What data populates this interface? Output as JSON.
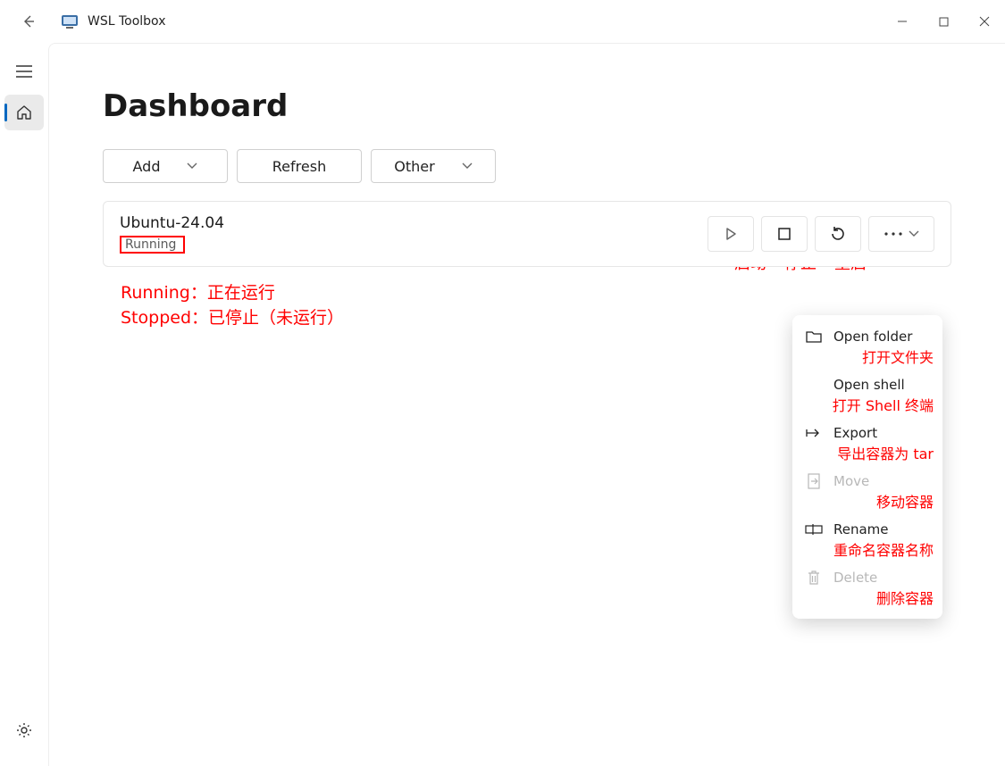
{
  "app": {
    "title": "WSL Toolbox"
  },
  "page": {
    "heading": "Dashboard"
  },
  "toolbar": {
    "add": "Add",
    "refresh": "Refresh",
    "other": "Other"
  },
  "action_labels": {
    "start": "启动",
    "stop": "停止",
    "restart": "重启"
  },
  "distro": {
    "name": "Ubuntu-24.04",
    "status": "Running"
  },
  "legend": {
    "running": "Running：正在运行",
    "stopped": "Stopped：已停止（未运行）"
  },
  "menu": {
    "open_folder": "Open folder",
    "open_folder_cn": "打开文件夹",
    "open_shell": "Open shell",
    "open_shell_cn": "打开 Shell 终端",
    "export": "Export",
    "export_cn": "导出容器为 tar",
    "move": "Move",
    "move_cn": "移动容器",
    "rename": "Rename",
    "rename_cn": "重命名容器名称",
    "delete": "Delete",
    "delete_cn": "删除容器"
  }
}
